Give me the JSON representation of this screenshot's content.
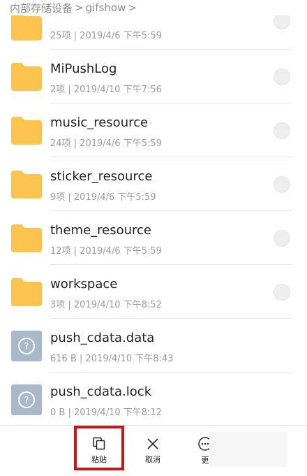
{
  "breadcrumb": {
    "root": "内部存储设备",
    "separator1": ">",
    "folder": "gifshow",
    "separator2": ">"
  },
  "items": [
    {
      "type": "folder",
      "name": "",
      "meta": "25项 | 2019/4/6 下午5:59"
    },
    {
      "type": "folder",
      "name": "MiPushLog",
      "meta": "2项 | 2019/4/10 下午7:56"
    },
    {
      "type": "folder",
      "name": "music_resource",
      "meta": "24项 | 2019/4/6 下午5:59"
    },
    {
      "type": "folder",
      "name": "sticker_resource",
      "meta": "9项 | 2019/4/6 下午5:59"
    },
    {
      "type": "folder",
      "name": "theme_resource",
      "meta": "12项 | 2019/4/6 下午5:59"
    },
    {
      "type": "folder",
      "name": "workspace",
      "meta": "3项 | 2019/4/10 下午8:52"
    },
    {
      "type": "file",
      "name": "push_cdata.data",
      "meta": "616 B | 2019/4/10 下午8:43"
    },
    {
      "type": "file",
      "name": "push_cdata.lock",
      "meta": "0 B | 2019/4/10 下午8:12"
    }
  ],
  "bottom_bar": {
    "paste_label": "粘贴",
    "cancel_label": "取消",
    "more_label": "更"
  },
  "colors": {
    "folder": "#fcc44e",
    "file_icon": "#a9b9c9",
    "highlight": "#c8161d"
  }
}
